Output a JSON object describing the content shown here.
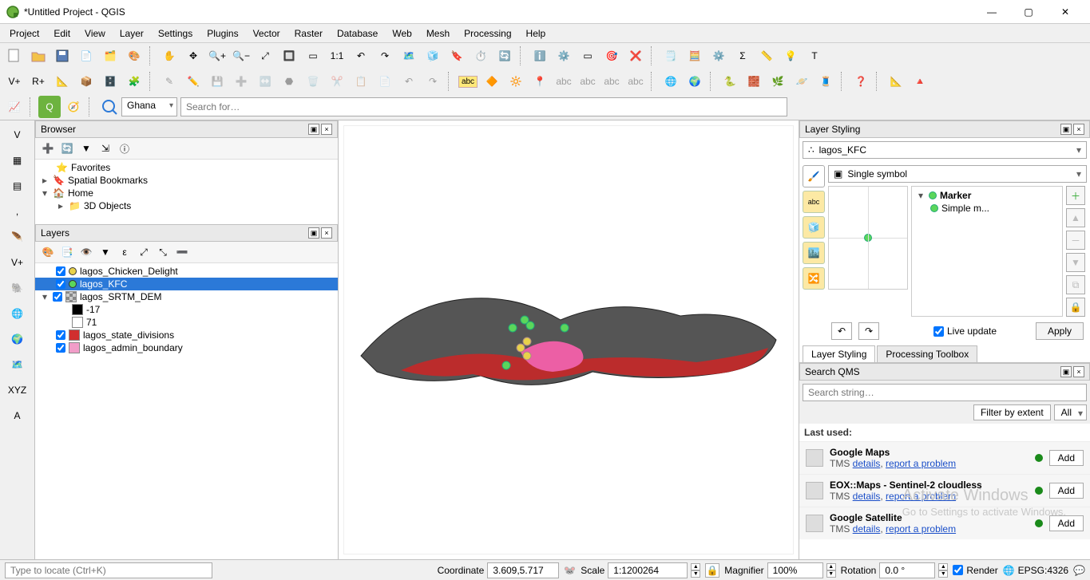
{
  "window": {
    "title": "*Untitled Project - QGIS"
  },
  "menus": [
    "Project",
    "Edit",
    "View",
    "Layer",
    "Settings",
    "Plugins",
    "Vector",
    "Raster",
    "Database",
    "Web",
    "Mesh",
    "Processing",
    "Help"
  ],
  "search": {
    "country": "Ghana",
    "placeholder": "Search for…"
  },
  "browser": {
    "title": "Browser",
    "items": [
      {
        "label": "Favorites",
        "icon": "star"
      },
      {
        "label": "Spatial Bookmarks",
        "icon": "bookmark",
        "expander": "▸"
      },
      {
        "label": "Home",
        "icon": "home",
        "expander": "▾"
      },
      {
        "label": "3D Objects",
        "icon": "folder",
        "indent": 1,
        "expander": "▸"
      }
    ]
  },
  "layers": {
    "title": "Layers",
    "items": [
      {
        "checked": true,
        "swatch_type": "point",
        "swatch_color": "#e8d24b",
        "label": "lagos_Chicken_Delight"
      },
      {
        "checked": true,
        "swatch_type": "point",
        "swatch_color": "#5bd65b",
        "label": "lagos_KFC",
        "selected": true
      },
      {
        "checked": true,
        "expander": "▾",
        "swatch_type": "raster",
        "swatch_color": "",
        "label": "lagos_SRTM_DEM"
      },
      {
        "indent": 1,
        "swatch_type": "square",
        "swatch_color": "#000000",
        "label": "-17"
      },
      {
        "indent": 1,
        "swatch_type": "square",
        "swatch_color": "#ffffff",
        "label": "71"
      },
      {
        "checked": true,
        "swatch_type": "square",
        "swatch_color": "#d12f2f",
        "label": "lagos_state_divisions"
      },
      {
        "checked": true,
        "swatch_type": "square",
        "swatch_color": "#f19dc8",
        "label": "lagos_admin_boundary"
      }
    ]
  },
  "styling": {
    "title": "Layer Styling",
    "layer": "lagos_KFC",
    "renderer": "Single symbol",
    "marker_label": "Marker",
    "simple_label": "Simple m...",
    "live_update": "Live update",
    "apply": "Apply",
    "tabs": {
      "a": "Layer Styling",
      "b": "Processing Toolbox"
    }
  },
  "qms": {
    "title": "Search QMS",
    "search_placeholder": "Search string…",
    "filter_extent": "Filter by extent",
    "filter_all": "All",
    "last_used": "Last used:",
    "items": [
      {
        "title": "Google Maps",
        "sub_pre": "TMS ",
        "details": "details",
        "sep": ", ",
        "report": "report a problem"
      },
      {
        "title": "EOX::Maps - Sentinel-2 cloudless",
        "sub_pre": "TMS ",
        "details": "details",
        "sep": ", ",
        "report": "report a problem"
      },
      {
        "title": "Google Satellite",
        "sub_pre": "TMS ",
        "details": "details",
        "sep": ", ",
        "report": "report a problem"
      }
    ],
    "add": "Add"
  },
  "watermark": {
    "l1": "Activate Windows",
    "l2": "Go to Settings to activate Windows."
  },
  "status": {
    "locator_placeholder": "Type to locate (Ctrl+K)",
    "coord_label": "Coordinate",
    "coord_value": "3.609,5.717",
    "scale_label": "Scale",
    "scale_value": "1:1200264",
    "magnifier_label": "Magnifier",
    "magnifier_value": "100%",
    "rotation_label": "Rotation",
    "rotation_value": "0.0 °",
    "render_label": "Render",
    "epsg": "EPSG:4326"
  }
}
